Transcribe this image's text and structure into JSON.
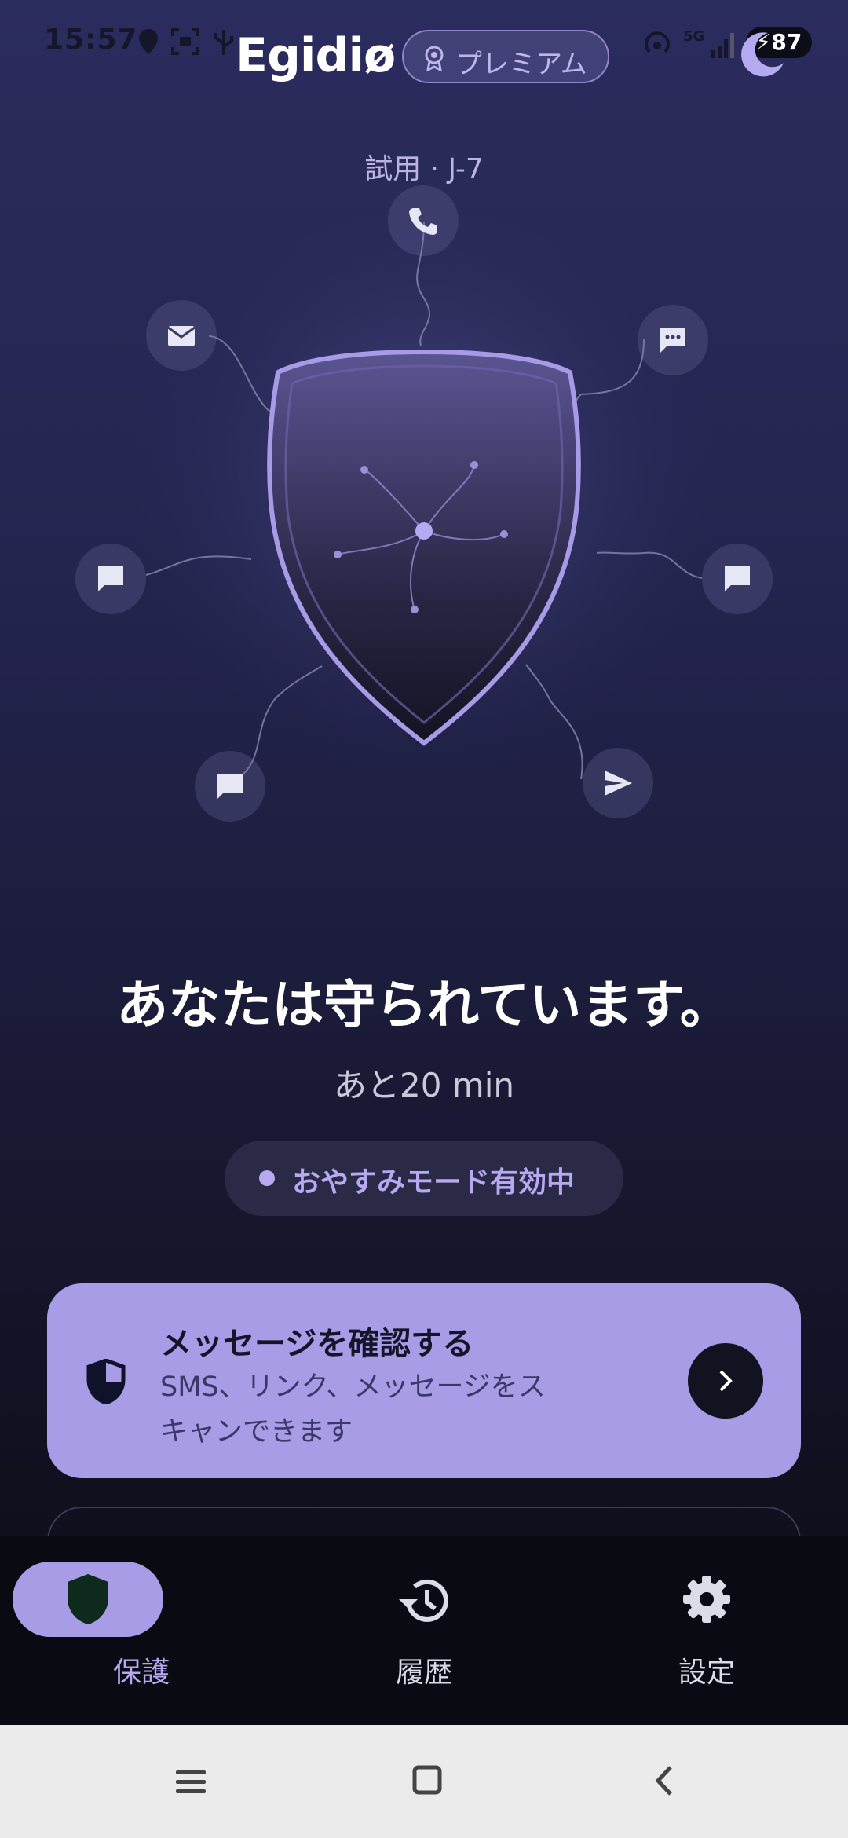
{
  "status_bar": {
    "time": "15:57",
    "network": "5G",
    "battery": "87"
  },
  "header": {
    "brand": "Egidiø",
    "premium_label": "プレミアム"
  },
  "trial_label": "試用 · J-7",
  "icons": {
    "nodes": [
      "phone-icon",
      "email-icon",
      "sms-icon",
      "chat-icon",
      "chat-icon",
      "chat-icon",
      "send-icon"
    ]
  },
  "status": {
    "headline": "あなたは守られています。",
    "remaining": "あと20 min",
    "mode": "おやすみモード有効中"
  },
  "check_card": {
    "title": "メッセージを確認する",
    "description": "SMS、リンク、メッセージをスキャンできます"
  },
  "bottom_nav": [
    {
      "label": "保護",
      "icon": "shield-icon",
      "active": true
    },
    {
      "label": "履歴",
      "icon": "history-icon",
      "active": false
    },
    {
      "label": "設定",
      "icon": "gear-icon",
      "active": false
    }
  ],
  "colors": {
    "accent": "#a99ce7",
    "background": "#1e1f45",
    "nav_bg": "#0a0b12"
  }
}
